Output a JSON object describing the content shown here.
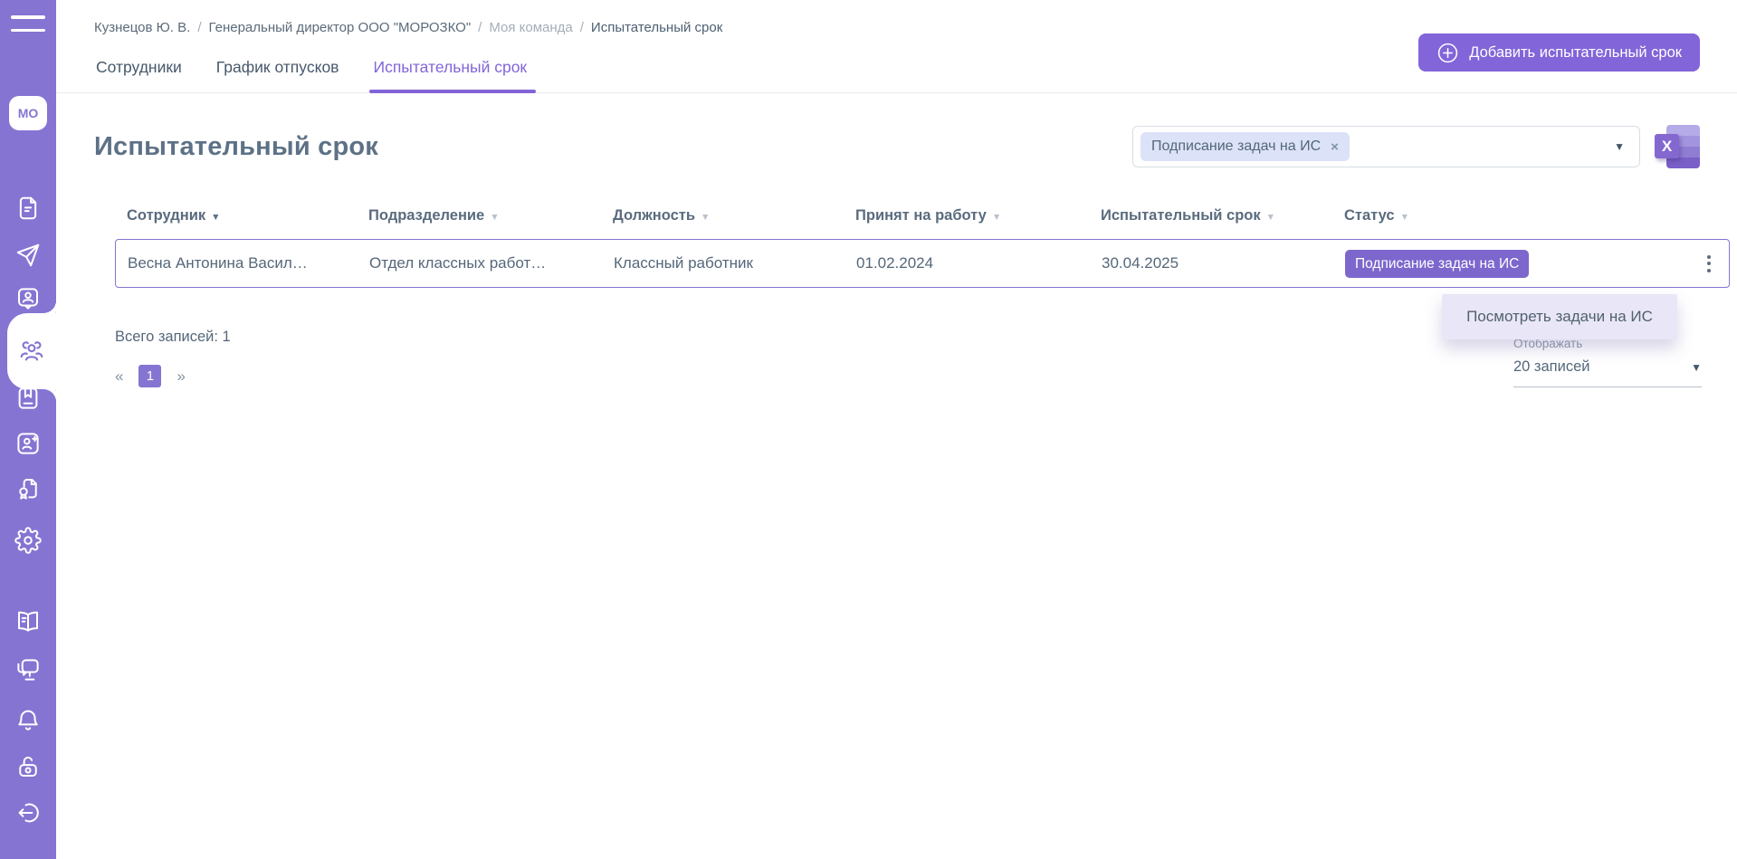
{
  "colors": {
    "sidebar": "#8674D2",
    "accent": "#8265D8",
    "badge": "#7D67CD",
    "chipBg": "#DCE2F7",
    "menuBg": "#E9E6F7",
    "rowBorder": "#8674D2",
    "text": "#55677A",
    "title": "#5D7186",
    "muted": "#9AA5B2",
    "border": "#D8DDE3",
    "excelDark": "#8468D0"
  },
  "sidebar": {
    "avatar": "МО"
  },
  "breadcrumb": {
    "separator": "/",
    "items": [
      "Кузнецов Ю. В.",
      "Генеральный директор ООО \"МОРОЗКО\"",
      "Моя команда",
      "Испытательный срок"
    ]
  },
  "tabs": {
    "items": [
      "Сотрудники",
      "График отпусков",
      "Испытательный срок"
    ]
  },
  "actions": {
    "add_label": "Добавить испытательный срок"
  },
  "page": {
    "title": "Испытательный срок"
  },
  "filter": {
    "chip": "Подписание задач на ИС",
    "close": "×",
    "arrow": "▼"
  },
  "export": {
    "letter": "X"
  },
  "table": {
    "sort_arrow": "▼",
    "columns": [
      "Сотрудник",
      "Подразделение",
      "Должность",
      "Принят на работу",
      "Испытательный срок",
      "Статус"
    ],
    "rows": [
      {
        "employee": "Весна Антонина Васил…",
        "department": "Отдел классных работ…",
        "position": "Классный работник",
        "hired": "01.02.2024",
        "probation_end": "30.04.2025",
        "status": "Подписание задач на ИС"
      }
    ]
  },
  "context_menu": {
    "items": [
      "Посмотреть задачи на ИС"
    ]
  },
  "footer": {
    "total": "Всего записей: 1",
    "pagination": {
      "prev": "«",
      "page": "1",
      "next": "»"
    },
    "display": {
      "label": "Отображать",
      "value": "20 записей",
      "arrow": "▼"
    }
  }
}
